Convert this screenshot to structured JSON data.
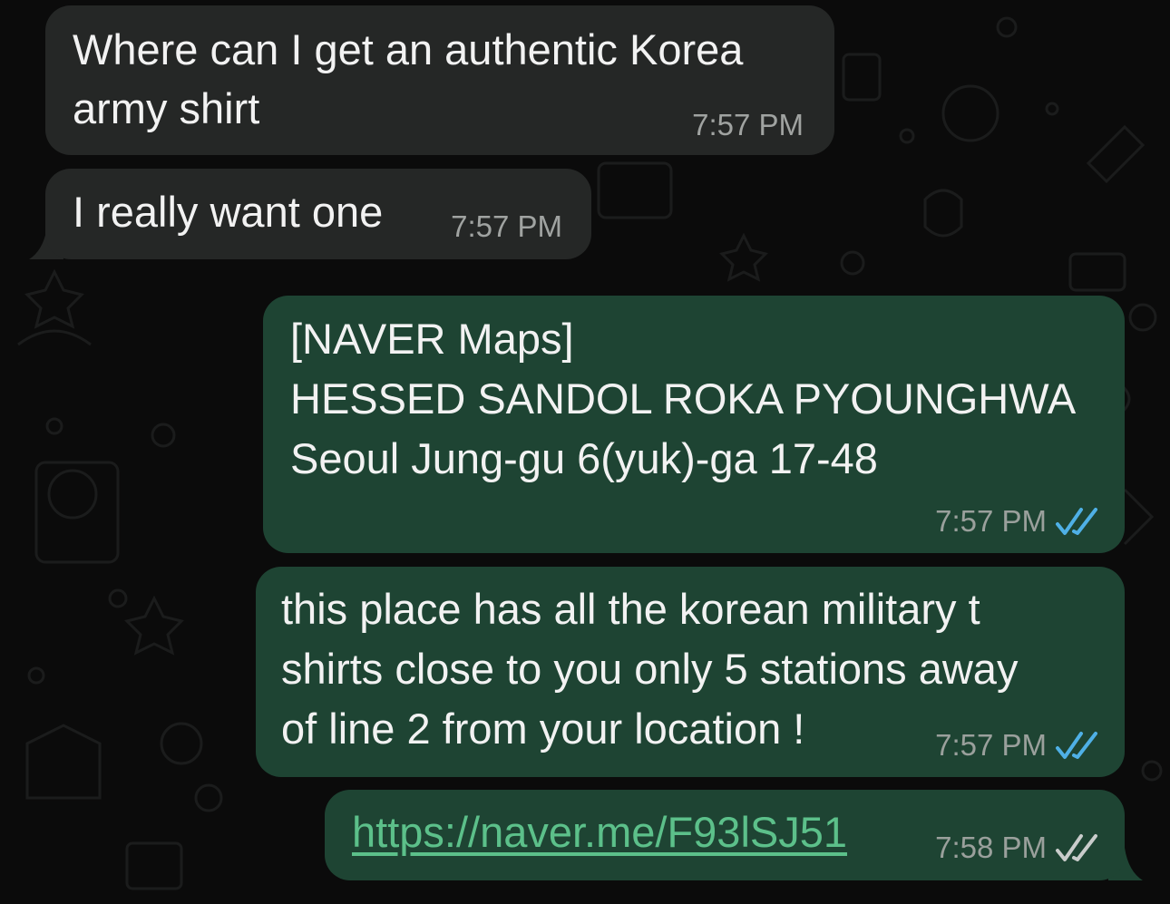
{
  "chat": {
    "messages": [
      {
        "direction": "incoming",
        "lines": [
          "Where can I get an authentic Korea",
          "army shirt"
        ],
        "time": "7:57 PM"
      },
      {
        "direction": "incoming",
        "lines": [
          "I really want one"
        ],
        "time": "7:57 PM"
      },
      {
        "direction": "outgoing",
        "lines": [
          "[NAVER Maps]",
          "HESSED SANDOL ROKA PYOUNGHWA",
          "Seoul Jung-gu 6(yuk)-ga 17-48"
        ],
        "time": "7:57 PM",
        "status": "read"
      },
      {
        "direction": "outgoing",
        "lines": [
          "this place has all the korean military t",
          "shirts close to you only 5 stations away",
          "of line 2 from your location !"
        ],
        "time": "7:57 PM",
        "status": "read"
      },
      {
        "direction": "outgoing",
        "link": "https://naver.me/F93lSJ51",
        "time": "7:58 PM",
        "status": "delivered"
      }
    ]
  },
  "colors": {
    "background": "#0b0b0b",
    "incoming_bubble": "#252726",
    "outgoing_bubble": "#1e4433",
    "link": "#5cc08a",
    "read_check": "#4fb0e6",
    "delivered_check": "#c9cccb",
    "timestamp": "#9aa09c"
  },
  "icons": {
    "read_status": "double-check-blue-icon",
    "delivered_status": "double-check-grey-icon"
  }
}
